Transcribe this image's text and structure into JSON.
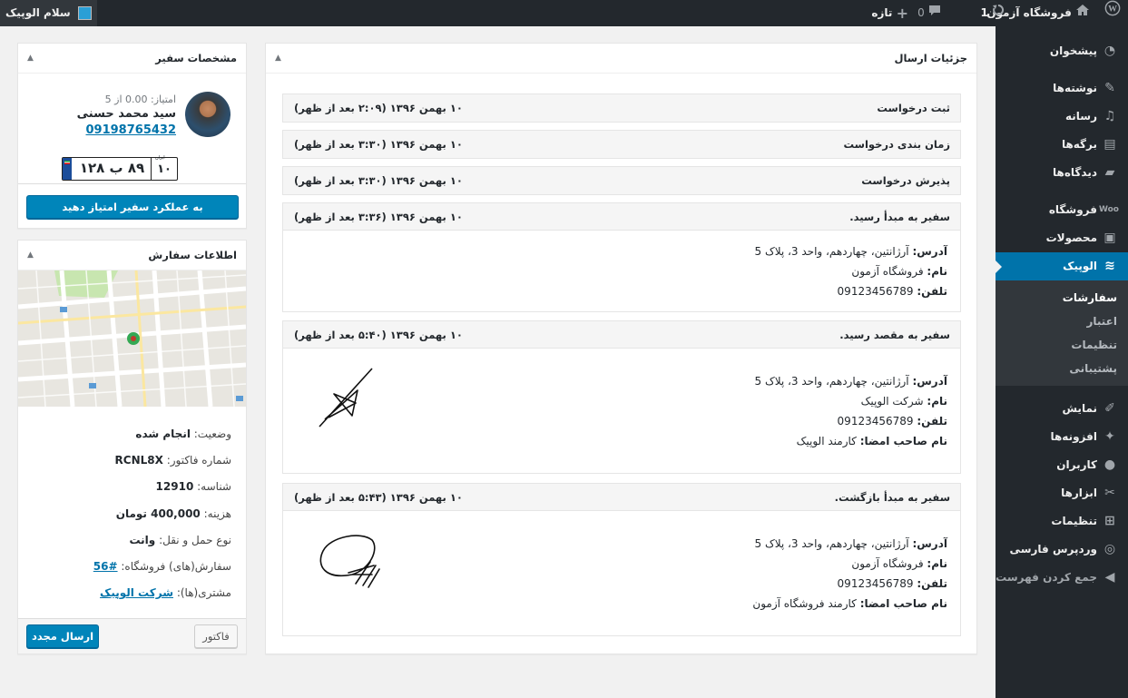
{
  "admin_bar": {
    "site_name": "فروشگاه آزمون",
    "updates_count": "1",
    "comments_count": "0",
    "new_label": "تازه",
    "account_label": "سلام الوپیک"
  },
  "admin_menu": {
    "items": [
      {
        "label": "پیشخوان",
        "icon": "dashboard-icon"
      },
      {
        "label": "نوشته‌ها",
        "icon": "pin-icon"
      },
      {
        "label": "رسانه",
        "icon": "media-icon"
      },
      {
        "label": "برگه‌ها",
        "icon": "pages-icon"
      },
      {
        "label": "دیدگاه‌ها",
        "icon": "comments-icon"
      },
      {
        "label": "فروشگاه",
        "icon": "woocommerce-icon"
      },
      {
        "label": "محصولات",
        "icon": "products-icon"
      },
      {
        "label": "الوپیک",
        "icon": "alopeyk-icon"
      },
      {
        "label": "نمایش",
        "icon": "appearance-icon"
      },
      {
        "label": "افزونه‌ها",
        "icon": "plugins-icon"
      },
      {
        "label": "کاربران",
        "icon": "users-icon"
      },
      {
        "label": "ابزارها",
        "icon": "tools-icon"
      },
      {
        "label": "تنظیمات",
        "icon": "settings-icon"
      },
      {
        "label": "وردپرس فارسی",
        "icon": "wp-persian-icon"
      },
      {
        "label": "جمع کردن فهرست",
        "icon": "collapse-icon"
      }
    ],
    "submenu": [
      "سفارشات",
      "اعتبار",
      "تنظیمات",
      "پشتیبانی"
    ]
  },
  "details_box": {
    "title": "جزئیات ارسال",
    "stages": [
      {
        "title": "ثبت درخواست",
        "date": "۱۰ بهمن ۱۳۹۶ (۲:۰۹ بعد از ظهر)"
      },
      {
        "title": "زمان بندی درخواست",
        "date": "۱۰ بهمن ۱۳۹۶ (۳:۳۰ بعد از ظهر)"
      },
      {
        "title": "پذیرش درخواست",
        "date": "۱۰ بهمن ۱۳۹۶ (۳:۳۰ بعد از ظهر)"
      },
      {
        "title": "سفیر به مبدأ رسید.",
        "date": "۱۰ بهمن ۱۳۹۶ (۳:۳۶ بعد از ظهر)",
        "address_label": "آدرس:",
        "address": "آرژانتین، چهاردهم، واحد 3، پلاک 5",
        "name_label": "نام:",
        "name": "فروشگاه آزمون",
        "phone_label": "تلفن:",
        "phone": "09123456789"
      },
      {
        "title": "سفیر به مقصد رسید.",
        "date": "۱۰ بهمن ۱۳۹۶ (۵:۴۰ بعد از ظهر)",
        "address_label": "آدرس:",
        "address": "آرژانتین، چهاردهم، واحد 3، پلاک 5",
        "name_label": "نام:",
        "name": "شرکت الوپیک",
        "phone_label": "تلفن:",
        "phone": "09123456789",
        "signer_label": "نام صاحب امضا:",
        "signer": "کارمند الوپیک"
      },
      {
        "title": "سفیر به مبدأ بازگشت.",
        "date": "۱۰ بهمن ۱۳۹۶ (۵:۴۳ بعد از ظهر)",
        "address_label": "آدرس:",
        "address": "آرژانتین، چهاردهم، واحد 3، پلاک 5",
        "name_label": "نام:",
        "name": "فروشگاه آزمون",
        "phone_label": "تلفن:",
        "phone": "09123456789",
        "signer_label": "نام صاحب امضا:",
        "signer": "کارمند فروشگاه آزمون"
      }
    ]
  },
  "courier_box": {
    "title": "مشخصات سفیر",
    "rating": "امتیاز: 0.00 از 5",
    "name": "سید محمد حسنی",
    "phone": "09198765432",
    "plate_main": "۸۹ ب ۱۲۸",
    "plate_region": "۱۰",
    "plate_region_caption": "ایران",
    "rate_button": "به عملکرد سفیر امتیاز دهید"
  },
  "order_box": {
    "title": "اطلاعات سفارش",
    "status_label": "وضعیت:",
    "status": "انجام شده",
    "invoice_label": "شماره فاکتور:",
    "invoice": "RCNL8X",
    "id_label": "شناسه:",
    "id": "12910",
    "cost_label": "هزینه:",
    "cost": "400,000 تومان",
    "transport_label": "نوع حمل و نقل:",
    "transport": "وانت",
    "shop_orders_label": "سفارش(های) فروشگاه:",
    "shop_orders": "#56",
    "customers_label": "مشتری(ها):",
    "customers": "شرکت الوپیک",
    "invoice_button": "فاکتور",
    "resend_button": "ارسال مجدد"
  }
}
